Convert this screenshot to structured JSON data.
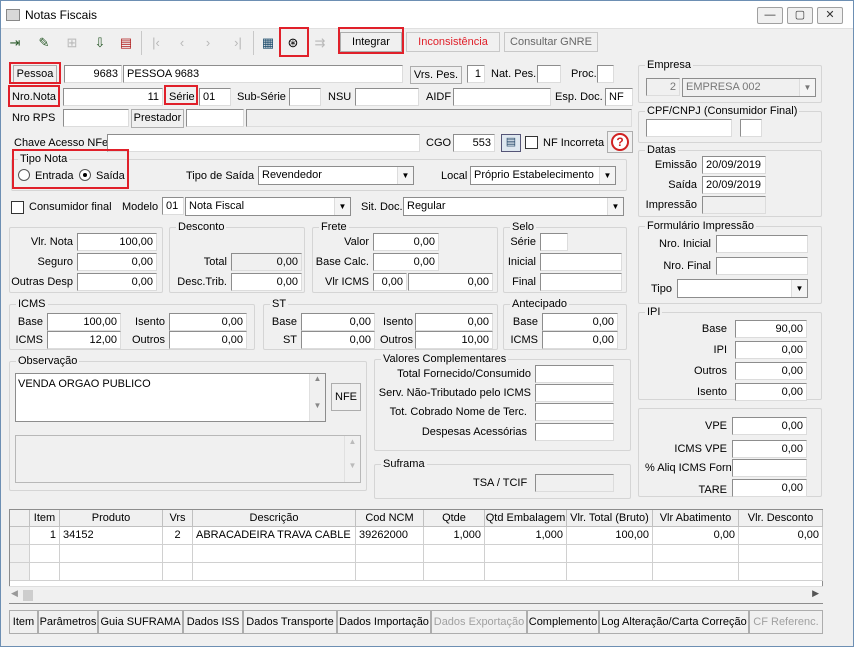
{
  "window": {
    "title": "Notas Fiscais",
    "minimize": "—",
    "restore": "▢",
    "close": "✕"
  },
  "toolbar": {
    "integrar": "Integrar",
    "inconsistencia": "Inconsistência",
    "consultar_gnre": "Consultar GNRE"
  },
  "pessoa": {
    "btn": "Pessoa",
    "code": "9683",
    "name": "PESSOA 9683",
    "vrs_btn": "Vrs. Pes.",
    "vrs": "1",
    "nat_label": "Nat. Pes.",
    "nat": "",
    "proc_label": "Proc."
  },
  "nota": {
    "nro_label": "Nro.Nota",
    "nro": "11",
    "serie_label": "Série",
    "serie": "01",
    "subserie_label": "Sub-Série",
    "subserie": "",
    "nsu_label": "NSU",
    "nsu": "",
    "aidf_label": "AIDF",
    "aidf": "",
    "espdoc_label": "Esp. Doc.",
    "espdoc": "NF",
    "rps_label": "Nro RPS",
    "rps": "",
    "prestador_btn": "Prestador",
    "prestador": "",
    "chave_label": "Chave Acesso NFe",
    "chave": "",
    "cgo_label": "CGO",
    "cgo": "553",
    "nf_incorreta": "NF Incorreta",
    "help": "?"
  },
  "tipo_nota": {
    "title": "Tipo Nota",
    "entrada": "Entrada",
    "saida": "Saída",
    "tipo_saida_label": "Tipo de Saída",
    "tipo_saida": "Revendedor",
    "local_label": "Local",
    "local": "Próprio Estabelecimento"
  },
  "consumidor": {
    "label": "Consumidor final",
    "modelo_label": "Modelo",
    "modelo_code": "01",
    "modelo": "Nota Fiscal",
    "sitdoc_label": "Sit. Doc.",
    "sitdoc": "Regular"
  },
  "valores": {
    "vlr_nota_label": "Vlr. Nota",
    "vlr_nota": "100,00",
    "seguro_label": "Seguro",
    "seguro": "0,00",
    "outras_label": "Outras Desp",
    "outras": "0,00"
  },
  "desconto": {
    "title": "Desconto",
    "total_label": "Total",
    "total": "0,00",
    "desc_trib_label": "Desc.Trib.",
    "desc_trib": "0,00"
  },
  "frete": {
    "title": "Frete",
    "valor_label": "Valor",
    "valor": "0,00",
    "base_label": "Base Calc.",
    "base": "0,00",
    "vlr_icms_label": "Vlr ICMS",
    "vlr_icms": "0,00",
    "vlr_icms2": "0,00"
  },
  "selo": {
    "title": "Selo",
    "serie_label": "Série",
    "inicial_label": "Inicial",
    "final_label": "Final"
  },
  "icms": {
    "title": "ICMS",
    "base_label": "Base",
    "base": "100,00",
    "icms_label": "ICMS",
    "icms": "12,00",
    "isento_label": "Isento",
    "isento": "0,00",
    "outros_label": "Outros",
    "outros": "0,00"
  },
  "st": {
    "title": "ST",
    "base_label": "Base",
    "base": "0,00",
    "st_label": "ST",
    "st": "0,00",
    "isento_label": "Isento",
    "isento": "0,00",
    "outros_label": "Outros",
    "outros": "10,00"
  },
  "antecipado": {
    "title": "Antecipado",
    "base_label": "Base",
    "base": "0,00",
    "icms_label": "ICMS",
    "icms": "0,00"
  },
  "observacao": {
    "title": "Observação",
    "text": "VENDA ORGAO PUBLICO",
    "nfe_btn": "NFE"
  },
  "complementares": {
    "title": "Valores Complementares",
    "total_fornecido": "Total Fornecido/Consumido",
    "serv_nao_trib": "Serv. Não-Tributado pelo ICMS",
    "tot_cobrado": "Tot. Cobrado Nome de Terc.",
    "despesas": "Despesas Acessórias"
  },
  "suframa": {
    "title": "Suframa",
    "tsa_label": "TSA / TCIF"
  },
  "empresa": {
    "title": "Empresa",
    "code": "2",
    "name": "EMPRESA 002"
  },
  "cpf": {
    "title": "CPF/CNPJ (Consumidor Final)"
  },
  "datas": {
    "title": "Datas",
    "emissao_label": "Emissão",
    "emissao": "20/09/2019",
    "saida_label": "Saída",
    "saida": "20/09/2019",
    "impressao_label": "Impressão"
  },
  "formulario": {
    "title": "Formulário Impressão",
    "nro_inicial": "Nro. Inicial",
    "nro_final": "Nro. Final",
    "tipo": "Tipo"
  },
  "ipi": {
    "title": "IPI",
    "base_label": "Base",
    "base": "90,00",
    "ipi_label": "IPI",
    "ipi": "0,00",
    "outros_label": "Outros",
    "outros": "0,00",
    "isento_label": "Isento",
    "isento": "0,00"
  },
  "vpe": {
    "vpe_label": "VPE",
    "vpe": "0,00",
    "icms_vpe_label": "ICMS VPE",
    "icms_vpe": "0,00",
    "aliq_label": "% Aliq ICMS Forn",
    "tare_label": "TARE",
    "tare": "0,00"
  },
  "grid": {
    "headers": [
      "Item",
      "Produto",
      "Vrs",
      "Descrição",
      "Cod NCM",
      "Qtde",
      "Qtd Embalagem",
      "Vlr. Total (Bruto)",
      "Vlr Abatimento",
      "Vlr. Desconto"
    ],
    "rows": [
      [
        "1",
        "34152",
        "2",
        "ABRACADEIRA TRAVA CABLE",
        "39262000",
        "1,000",
        "1,000",
        "100,00",
        "0,00",
        "0,00"
      ]
    ]
  },
  "tabs": [
    "Item",
    "Parâmetros",
    "Guia SUFRAMA",
    "Dados ISS",
    "Dados Transporte",
    "Dados Importação",
    "Dados Exportação",
    "Complemento",
    "Log Alteração/Carta Correção",
    "CF Referenc."
  ]
}
